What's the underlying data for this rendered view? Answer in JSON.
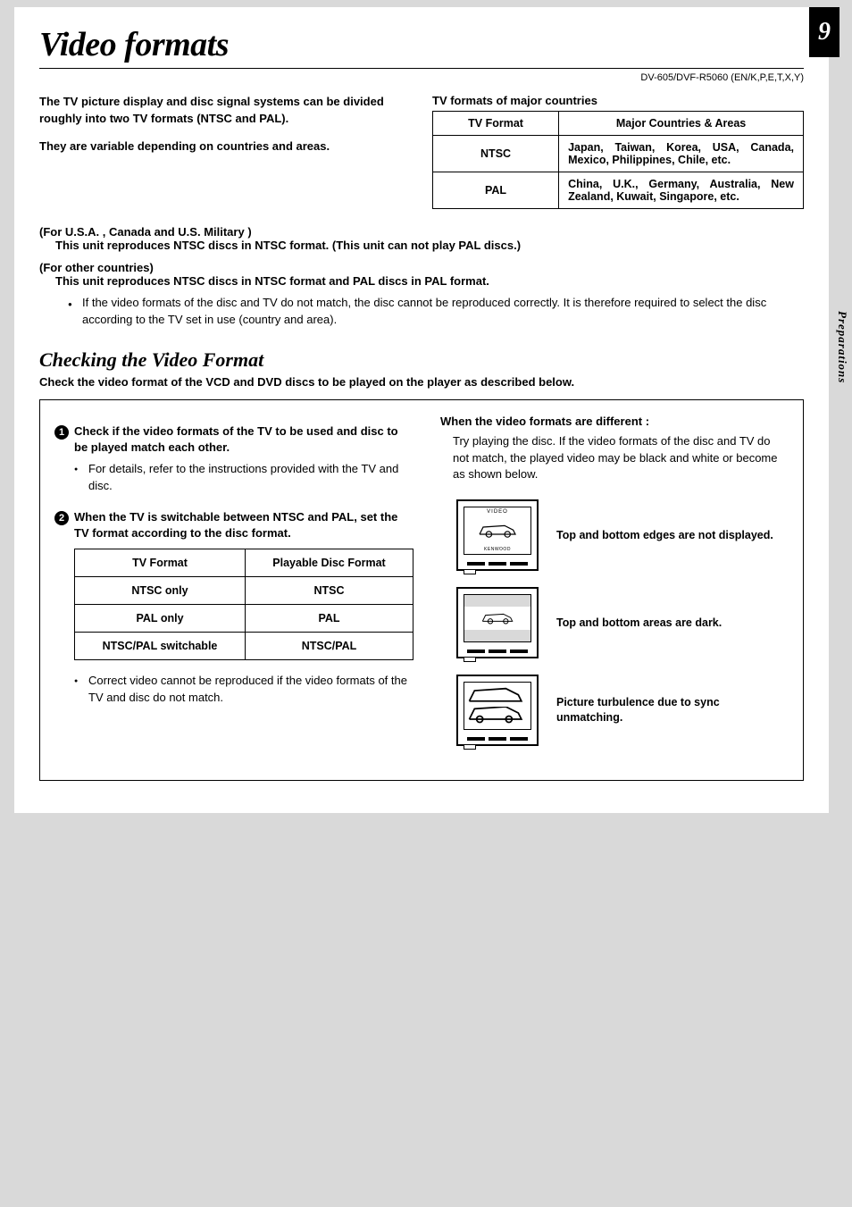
{
  "page_number": "9",
  "side_tab": "Preparations",
  "title": "Video formats",
  "model_line": "DV-605/DVF-R5060 (EN/K,P,E,T,X,Y)",
  "intro": {
    "p1": "The TV picture display and disc signal systems can be divided roughly into two TV formats (NTSC and PAL).",
    "p2": " They are variable depending on countries and areas."
  },
  "formats_table": {
    "caption": "TV formats of major countries",
    "headers": {
      "c1": "TV Format",
      "c2": "Major Countries & Areas"
    },
    "rows": [
      {
        "c1": "NTSC",
        "c2": "Japan, Taiwan, Korea, USA, Canada, Mexico, Philippines, Chile, etc."
      },
      {
        "c1": "PAL",
        "c2": "China, U.K., Germany, Australia, New Zealand, Kuwait, Singapore, etc."
      }
    ]
  },
  "region1": {
    "header": "(For  U.S.A. , Canada and U.S. Military )",
    "body": "This unit reproduces NTSC discs in NTSC format. (This unit can not play PAL discs.)"
  },
  "region2": {
    "header": "(For other countries)",
    "body": "This unit reproduces NTSC discs in NTSC format and PAL discs in PAL format."
  },
  "note_bullet": "If the video formats of the disc and TV do not match, the disc cannot be reproduced correctly. It is therefore required to select the disc according to the TV set in use (country and area).",
  "subhead": "Checking the Video Format",
  "subhead_desc": "Check the video format of the VCD and DVD discs to be played on the player as described below.",
  "step1": {
    "text": "Check if the video formats of the TV to be used and disc to be played match each other.",
    "bullet": "For details, refer to the instructions provided with the TV and disc."
  },
  "step2": {
    "text": "When the TV is switchable between NTSC and PAL, set the TV format according to the disc format."
  },
  "playable_table": {
    "headers": {
      "c1": "TV Format",
      "c2": "Playable Disc Format"
    },
    "rows": [
      {
        "c1": "NTSC only",
        "c2": "NTSC"
      },
      {
        "c1": "PAL only",
        "c2": "PAL"
      },
      {
        "c1": "NTSC/PAL switchable",
        "c2": "NTSC/PAL"
      }
    ]
  },
  "left_note": "Correct video cannot be reproduced if the video formats of the TV and disc do not match.",
  "right": {
    "heading": "When the video formats are different :",
    "desc": "Try playing the disc. If the video formats of the disc and TV do not match, the played video may be black and white or become as shown below.",
    "items": [
      "Top and bottom edges are not displayed.",
      "Top and bottom areas are dark.",
      "Picture turbulence due to sync unmatching."
    ],
    "labels": {
      "video": "VIDEO",
      "brand": "KENWOOD"
    }
  }
}
